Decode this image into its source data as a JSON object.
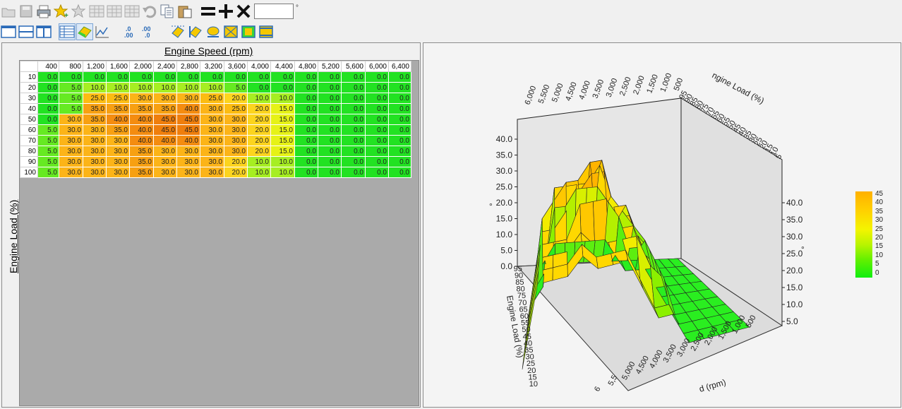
{
  "toolbar_top": {
    "buttons": [
      {
        "name": "open-folder-button",
        "icon": "folder-icon"
      },
      {
        "name": "save-button",
        "icon": "save-icon"
      },
      {
        "name": "print-button",
        "icon": "printer-icon"
      },
      {
        "name": "add-favorite-button",
        "icon": "star-plus-icon"
      },
      {
        "name": "remove-favorite-button",
        "icon": "star-minus-icon"
      },
      {
        "name": "table-insert-button",
        "icon": "table-grid-icon"
      },
      {
        "name": "table-delete-button",
        "icon": "table-grid-icon"
      },
      {
        "name": "table-options-button",
        "icon": "table-grid-icon"
      },
      {
        "name": "undo-button",
        "icon": "undo-icon"
      },
      {
        "name": "copy-button",
        "icon": "copy-icon"
      },
      {
        "name": "paste-button",
        "icon": "paste-icon"
      }
    ],
    "operators": {
      "set": "=",
      "add": "+",
      "multiply": "×"
    },
    "op_value": "",
    "unit": "°"
  },
  "toolbar_bottom": {
    "views": [
      "view-single",
      "view-horizontal-split",
      "view-vertical-split",
      "view-table",
      "view-3d",
      "view-2d-graph"
    ],
    "decimal_left": ".0\n.00",
    "decimal_right": ".00\n.0",
    "tools": [
      "interpolate-horizontal",
      "interpolate-vertical",
      "smooth",
      "select-all",
      "fill",
      "clear"
    ]
  },
  "table": {
    "x_title": "Engine Speed (rpm)",
    "y_title": "Engine Load (%)",
    "rpm": [
      "400",
      "800",
      "1,200",
      "1,600",
      "2,000",
      "2,400",
      "2,800",
      "3,200",
      "3,600",
      "4,000",
      "4,400",
      "4,800",
      "5,200",
      "5,600",
      "6,000",
      "6,400"
    ],
    "load": [
      "10",
      "20",
      "30",
      "40",
      "50",
      "60",
      "70",
      "80",
      "90",
      "100"
    ],
    "values": [
      [
        "0.0",
        "0.0",
        "0.0",
        "0.0",
        "0.0",
        "0.0",
        "0.0",
        "0.0",
        "0.0",
        "0.0",
        "0.0",
        "0.0",
        "0.0",
        "0.0",
        "0.0",
        "0.0"
      ],
      [
        "0.0",
        "5.0",
        "10.0",
        "10.0",
        "10.0",
        "10.0",
        "10.0",
        "10.0",
        "5.0",
        "0.0",
        "0.0",
        "0.0",
        "0.0",
        "0.0",
        "0.0",
        "0.0"
      ],
      [
        "0.0",
        "5.0",
        "25.0",
        "25.0",
        "30.0",
        "30.0",
        "30.0",
        "25.0",
        "20.0",
        "10.0",
        "10.0",
        "0.0",
        "0.0",
        "0.0",
        "0.0",
        "0.0"
      ],
      [
        "0.0",
        "5.0",
        "35.0",
        "35.0",
        "35.0",
        "35.0",
        "40.0",
        "30.0",
        "25.0",
        "20.0",
        "15.0",
        "0.0",
        "0.0",
        "0.0",
        "0.0",
        "0.0"
      ],
      [
        "0.0",
        "30.0",
        "35.0",
        "40.0",
        "40.0",
        "45.0",
        "45.0",
        "30.0",
        "30.0",
        "20.0",
        "15.0",
        "0.0",
        "0.0",
        "0.0",
        "0.0",
        "0.0"
      ],
      [
        "5.0",
        "30.0",
        "30.0",
        "35.0",
        "40.0",
        "45.0",
        "45.0",
        "30.0",
        "30.0",
        "20.0",
        "15.0",
        "0.0",
        "0.0",
        "0.0",
        "0.0",
        "0.0"
      ],
      [
        "5.0",
        "30.0",
        "30.0",
        "30.0",
        "40.0",
        "40.0",
        "40.0",
        "30.0",
        "30.0",
        "20.0",
        "15.0",
        "0.0",
        "0.0",
        "0.0",
        "0.0",
        "0.0"
      ],
      [
        "5.0",
        "30.0",
        "30.0",
        "30.0",
        "35.0",
        "30.0",
        "30.0",
        "30.0",
        "30.0",
        "20.0",
        "15.0",
        "0.0",
        "0.0",
        "0.0",
        "0.0",
        "0.0"
      ],
      [
        "5.0",
        "30.0",
        "30.0",
        "30.0",
        "35.0",
        "30.0",
        "30.0",
        "30.0",
        "20.0",
        "10.0",
        "10.0",
        "0.0",
        "0.0",
        "0.0",
        "0.0",
        "0.0"
      ],
      [
        "5.0",
        "30.0",
        "30.0",
        "30.0",
        "35.0",
        "30.0",
        "30.0",
        "30.0",
        "20.0",
        "10.0",
        "10.0",
        "0.0",
        "0.0",
        "0.0",
        "0.0",
        "0.0"
      ]
    ],
    "colors": {
      "c0": "#22e222",
      "c5": "#66ea22",
      "c10": "#a6ee22",
      "c15": "#e6f216",
      "c20": "#fcd41e",
      "c25": "#fcbc12",
      "c30": "#fcb418",
      "c35": "#f7a012",
      "c40": "#f48c10",
      "c45": "#ef7e0c"
    }
  },
  "plot3d": {
    "z_ticks": [
      "0.0",
      "5.0",
      "10.0",
      "15.0",
      "20.0",
      "25.0",
      "30.0",
      "35.0",
      "40.0"
    ],
    "z_ticks_right": [
      "5.0",
      "10.0",
      "15.0",
      "20.0",
      "25.0",
      "30.0",
      "35.0",
      "40.0"
    ],
    "rpm_top_ticks": [
      "6,000",
      "5,500",
      "5,000",
      "4,500",
      "4,000",
      "3,500",
      "3,000",
      "2,500",
      "2,000",
      "1,500",
      "1,000",
      "500"
    ],
    "load_top_ticks": [
      "5",
      "10",
      "15",
      "20",
      "25",
      "30",
      "35",
      "40",
      "45",
      "50",
      "55",
      "60",
      "65",
      "70",
      "75",
      "80",
      "85",
      "90",
      "95"
    ],
    "load_left_ticks": [
      "10",
      "15",
      "20",
      "25",
      "30",
      "35",
      "40",
      "45",
      "50",
      "55",
      "60",
      "65",
      "70",
      "75",
      "80",
      "85",
      "90",
      "95"
    ],
    "rpm_bottom_ticks": [
      "6",
      "5,5",
      "5,000",
      "4,500",
      "4,000",
      "3,500",
      "3,000",
      "2,500",
      "2,000",
      "1,500",
      "1,000",
      "500"
    ],
    "load_axis_title_top": "ngine Load (%)",
    "load_axis_title_left": "Engine Load (%)",
    "rpm_axis_title_bottom": "d (rpm)",
    "z_unit_left": "°",
    "z_unit_right": "°",
    "legend": [
      "45",
      "40",
      "35",
      "30",
      "25",
      "20",
      "15",
      "10",
      "5",
      "0"
    ]
  }
}
